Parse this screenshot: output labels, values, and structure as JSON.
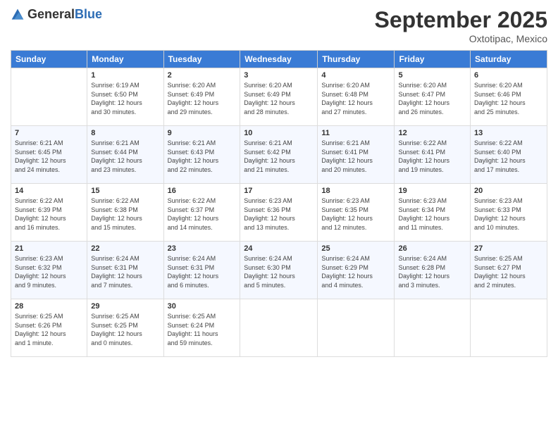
{
  "header": {
    "logo_general": "General",
    "logo_blue": "Blue",
    "month_year": "September 2025",
    "location": "Oxtotipac, Mexico"
  },
  "days_of_week": [
    "Sunday",
    "Monday",
    "Tuesday",
    "Wednesday",
    "Thursday",
    "Friday",
    "Saturday"
  ],
  "weeks": [
    [
      {
        "day": "",
        "info": ""
      },
      {
        "day": "1",
        "info": "Sunrise: 6:19 AM\nSunset: 6:50 PM\nDaylight: 12 hours\nand 30 minutes."
      },
      {
        "day": "2",
        "info": "Sunrise: 6:20 AM\nSunset: 6:49 PM\nDaylight: 12 hours\nand 29 minutes."
      },
      {
        "day": "3",
        "info": "Sunrise: 6:20 AM\nSunset: 6:49 PM\nDaylight: 12 hours\nand 28 minutes."
      },
      {
        "day": "4",
        "info": "Sunrise: 6:20 AM\nSunset: 6:48 PM\nDaylight: 12 hours\nand 27 minutes."
      },
      {
        "day": "5",
        "info": "Sunrise: 6:20 AM\nSunset: 6:47 PM\nDaylight: 12 hours\nand 26 minutes."
      },
      {
        "day": "6",
        "info": "Sunrise: 6:20 AM\nSunset: 6:46 PM\nDaylight: 12 hours\nand 25 minutes."
      }
    ],
    [
      {
        "day": "7",
        "info": "Sunrise: 6:21 AM\nSunset: 6:45 PM\nDaylight: 12 hours\nand 24 minutes."
      },
      {
        "day": "8",
        "info": "Sunrise: 6:21 AM\nSunset: 6:44 PM\nDaylight: 12 hours\nand 23 minutes."
      },
      {
        "day": "9",
        "info": "Sunrise: 6:21 AM\nSunset: 6:43 PM\nDaylight: 12 hours\nand 22 minutes."
      },
      {
        "day": "10",
        "info": "Sunrise: 6:21 AM\nSunset: 6:42 PM\nDaylight: 12 hours\nand 21 minutes."
      },
      {
        "day": "11",
        "info": "Sunrise: 6:21 AM\nSunset: 6:41 PM\nDaylight: 12 hours\nand 20 minutes."
      },
      {
        "day": "12",
        "info": "Sunrise: 6:22 AM\nSunset: 6:41 PM\nDaylight: 12 hours\nand 19 minutes."
      },
      {
        "day": "13",
        "info": "Sunrise: 6:22 AM\nSunset: 6:40 PM\nDaylight: 12 hours\nand 17 minutes."
      }
    ],
    [
      {
        "day": "14",
        "info": "Sunrise: 6:22 AM\nSunset: 6:39 PM\nDaylight: 12 hours\nand 16 minutes."
      },
      {
        "day": "15",
        "info": "Sunrise: 6:22 AM\nSunset: 6:38 PM\nDaylight: 12 hours\nand 15 minutes."
      },
      {
        "day": "16",
        "info": "Sunrise: 6:22 AM\nSunset: 6:37 PM\nDaylight: 12 hours\nand 14 minutes."
      },
      {
        "day": "17",
        "info": "Sunrise: 6:23 AM\nSunset: 6:36 PM\nDaylight: 12 hours\nand 13 minutes."
      },
      {
        "day": "18",
        "info": "Sunrise: 6:23 AM\nSunset: 6:35 PM\nDaylight: 12 hours\nand 12 minutes."
      },
      {
        "day": "19",
        "info": "Sunrise: 6:23 AM\nSunset: 6:34 PM\nDaylight: 12 hours\nand 11 minutes."
      },
      {
        "day": "20",
        "info": "Sunrise: 6:23 AM\nSunset: 6:33 PM\nDaylight: 12 hours\nand 10 minutes."
      }
    ],
    [
      {
        "day": "21",
        "info": "Sunrise: 6:23 AM\nSunset: 6:32 PM\nDaylight: 12 hours\nand 9 minutes."
      },
      {
        "day": "22",
        "info": "Sunrise: 6:24 AM\nSunset: 6:31 PM\nDaylight: 12 hours\nand 7 minutes."
      },
      {
        "day": "23",
        "info": "Sunrise: 6:24 AM\nSunset: 6:31 PM\nDaylight: 12 hours\nand 6 minutes."
      },
      {
        "day": "24",
        "info": "Sunrise: 6:24 AM\nSunset: 6:30 PM\nDaylight: 12 hours\nand 5 minutes."
      },
      {
        "day": "25",
        "info": "Sunrise: 6:24 AM\nSunset: 6:29 PM\nDaylight: 12 hours\nand 4 minutes."
      },
      {
        "day": "26",
        "info": "Sunrise: 6:24 AM\nSunset: 6:28 PM\nDaylight: 12 hours\nand 3 minutes."
      },
      {
        "day": "27",
        "info": "Sunrise: 6:25 AM\nSunset: 6:27 PM\nDaylight: 12 hours\nand 2 minutes."
      }
    ],
    [
      {
        "day": "28",
        "info": "Sunrise: 6:25 AM\nSunset: 6:26 PM\nDaylight: 12 hours\nand 1 minute."
      },
      {
        "day": "29",
        "info": "Sunrise: 6:25 AM\nSunset: 6:25 PM\nDaylight: 12 hours\nand 0 minutes."
      },
      {
        "day": "30",
        "info": "Sunrise: 6:25 AM\nSunset: 6:24 PM\nDaylight: 11 hours\nand 59 minutes."
      },
      {
        "day": "",
        "info": ""
      },
      {
        "day": "",
        "info": ""
      },
      {
        "day": "",
        "info": ""
      },
      {
        "day": "",
        "info": ""
      }
    ]
  ]
}
